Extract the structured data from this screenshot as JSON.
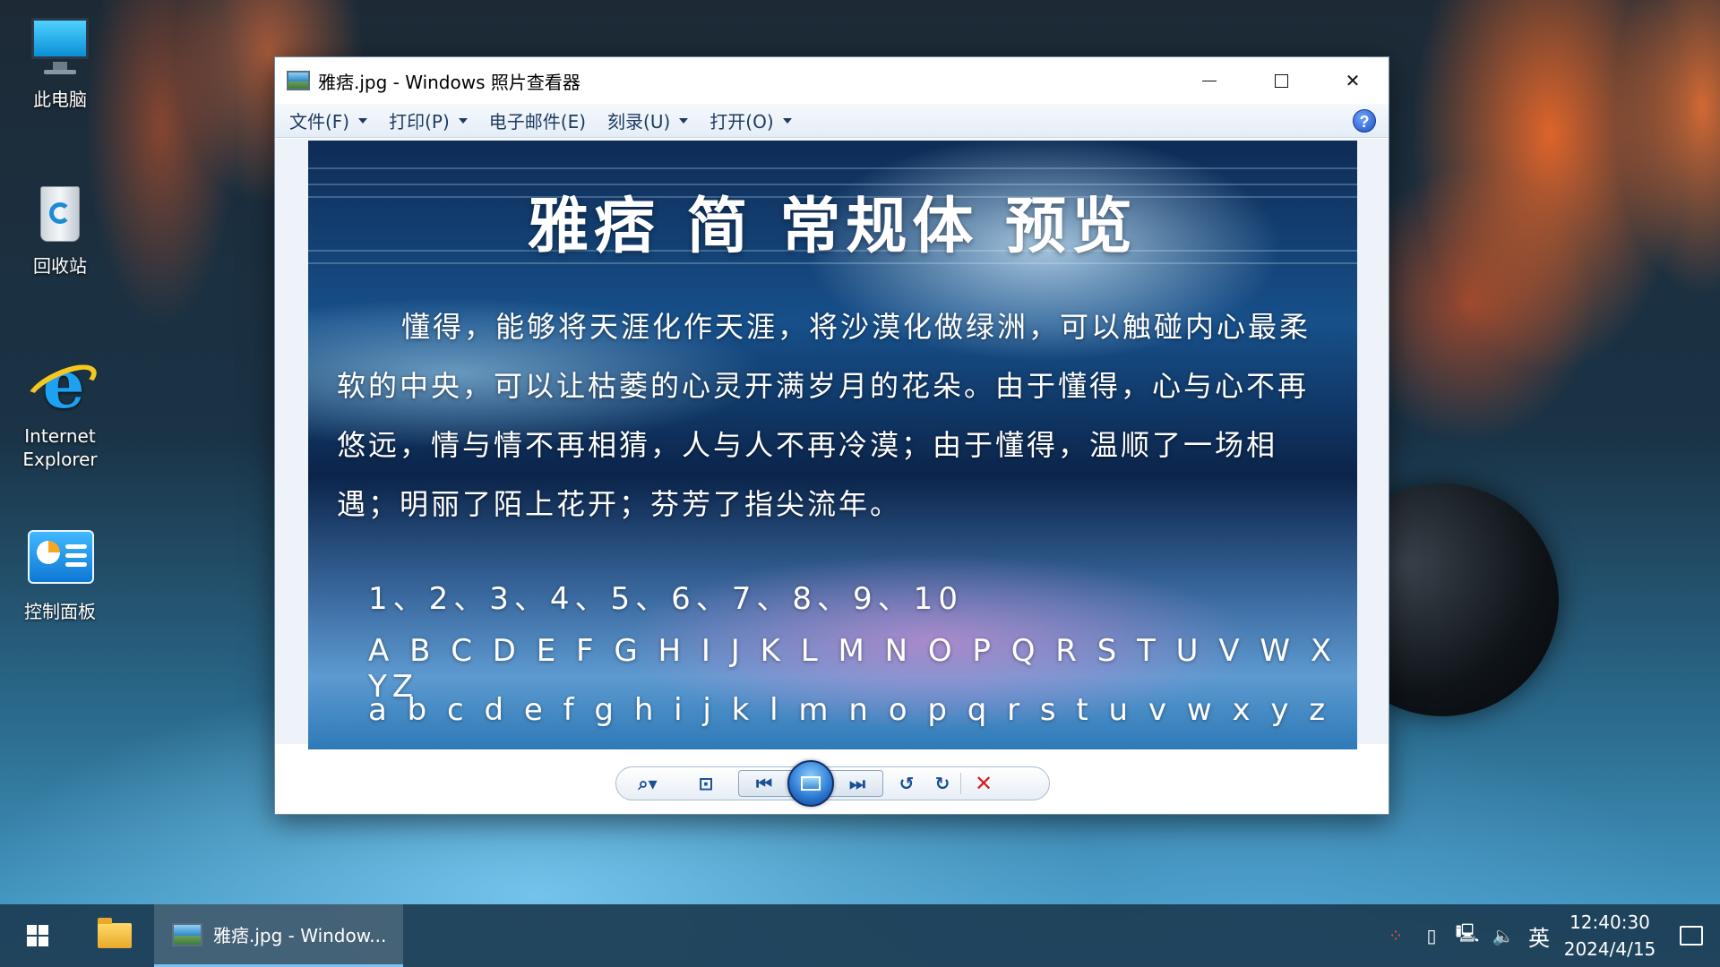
{
  "desktop": {
    "icons": [
      {
        "label": "此电脑"
      },
      {
        "label": "回收站"
      },
      {
        "label": "Internet Explorer"
      },
      {
        "label": "控制面板"
      }
    ]
  },
  "window": {
    "title": "雅痞.jpg - Windows 照片查看器",
    "controls": {
      "minimize": "–",
      "maximize": "□",
      "close": "✕"
    },
    "menu": [
      {
        "label": "文件(F)"
      },
      {
        "label": "打印(P)"
      },
      {
        "label": "电子邮件(E)"
      },
      {
        "label": "刻录(U)"
      },
      {
        "label": "打开(O)"
      }
    ],
    "help": "?"
  },
  "photo": {
    "title": "雅痞 简 常规体 预览",
    "paragraph": "懂得，能够将天涯化作天涯，将沙漠化做绿洲，可以触碰内心最柔软的中央，可以让枯萎的心灵开满岁月的花朵。由于懂得，心与心不再悠远，情与情不再相猜，人与人不再冷漠；由于懂得，温顺了一场相遇；明丽了陌上花开；芬芳了指尖流年。",
    "numbers": "1、2、3、4、5、6、7、8、9、10",
    "uppercase": "A B C D E F G H I J K L M N O P Q R S T U V W X YZ",
    "lowercase": "a b c d e f g h i j k l m n o p q r s t u v w x y z"
  },
  "navbar": {
    "zoom": "⌕▾",
    "fit": "⊡",
    "previous": "⏮",
    "next": "⏭",
    "rotate_left": "↺",
    "rotate_right": "↻",
    "delete": "✕"
  },
  "taskbar": {
    "app_label": "雅痞.jpg - Window...",
    "tray": {
      "ime": "英",
      "volume": "🔈",
      "network": "🖳",
      "device": "▯",
      "dots": "⁘"
    },
    "time": "12:40:30",
    "date": "2024/4/15"
  }
}
